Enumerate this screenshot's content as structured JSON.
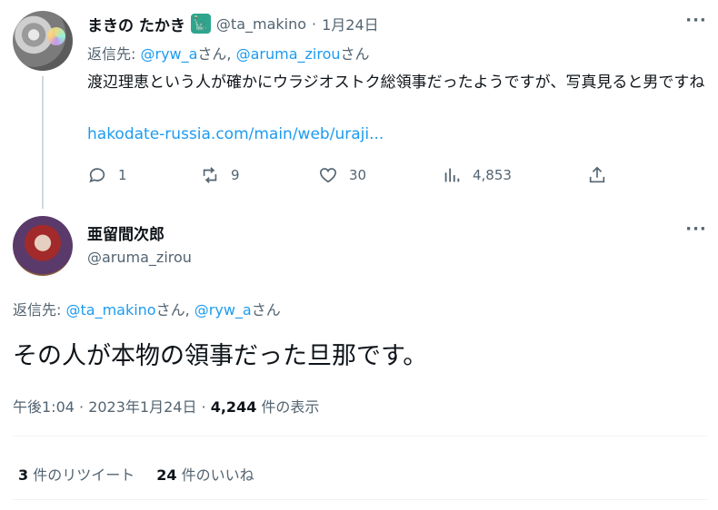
{
  "tweet1": {
    "name": "まきの たかき",
    "handle": "@ta_makino",
    "separator": "·",
    "date": "1月24日",
    "reply_prefix": "返信先: ",
    "reply_user1": "@ryw_a",
    "reply_san1": "さん, ",
    "reply_user2": "@aruma_zirou",
    "reply_san2": "さん",
    "text": "渡辺理恵という人が確かにウラジオストク総領事だったようですが、写真見ると男ですね",
    "url": "hakodate-russia.com/main/web/uraji...",
    "actions": {
      "replies": "1",
      "retweets": "9",
      "likes": "30",
      "views": "4,853"
    },
    "icons": [
      "reply-icon",
      "retweet-icon",
      "like-icon",
      "views-icon",
      "share-icon",
      "statue-of-liberty-emoji",
      "more-icon"
    ]
  },
  "tweet2": {
    "name": "亜留間次郎",
    "handle": "@aruma_zirou",
    "reply_prefix": "返信先: ",
    "reply_user1": "@ta_makino",
    "reply_san1": "さん, ",
    "reply_user2": "@ryw_a",
    "reply_san2": "さん",
    "text": "その人が本物の領事だった旦那です。",
    "time": "午後1:04 · 2023年1月24日 · ",
    "views_count": "4,244",
    "views_label": " 件の表示",
    "retweet_count": "3",
    "retweet_label": " 件のリツイート",
    "like_count": "24",
    "like_label": " 件のいいね"
  },
  "colors": {
    "link": "#1d9bf0",
    "muted": "#536471",
    "text": "#0f1419",
    "divider": "#eff3f4"
  }
}
